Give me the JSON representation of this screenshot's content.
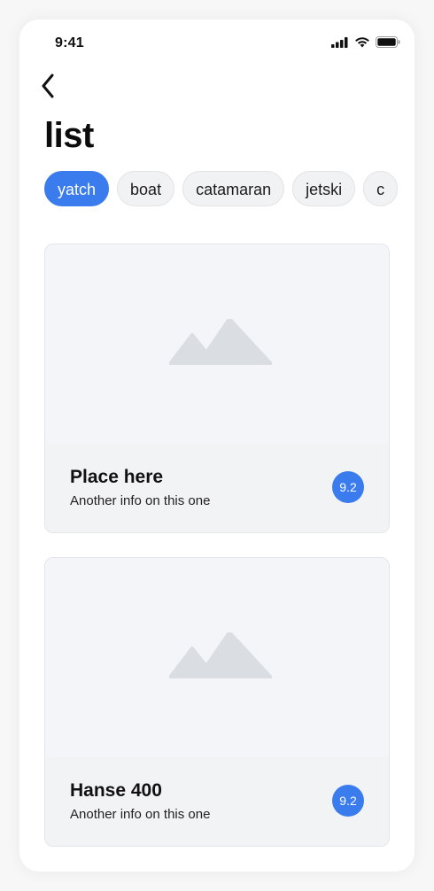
{
  "status_bar": {
    "time": "9:41"
  },
  "header": {
    "back_icon": "chevron-left-icon",
    "title": "list"
  },
  "filters": {
    "chips": [
      {
        "label": "yatch",
        "selected": true
      },
      {
        "label": "boat",
        "selected": false
      },
      {
        "label": "catamaran",
        "selected": false
      },
      {
        "label": "jetski",
        "selected": false
      },
      {
        "label": "c",
        "selected": false
      }
    ]
  },
  "cards": [
    {
      "title": "Place here",
      "subtitle": "Another info on this one",
      "score": "9.2",
      "image_icon": "mountain-image-placeholder-icon"
    },
    {
      "title": "Hanse 400",
      "subtitle": "Another info on this one",
      "score": "9.2",
      "image_icon": "mountain-image-placeholder-icon"
    }
  ],
  "colors": {
    "accent": "#3a7bee",
    "chip_bg": "#f1f2f4",
    "card_bg": "#f4f5f9",
    "placeholder": "#dadde2"
  }
}
